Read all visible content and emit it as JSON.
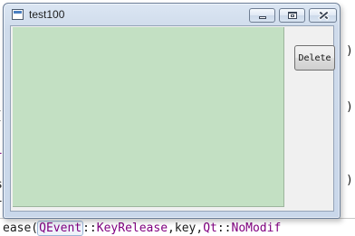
{
  "window": {
    "title": "test100",
    "delete_label": "Delete"
  },
  "editor": {
    "right_paren_1": ")",
    "right_paren_2": ")",
    "right_paren_3": ")",
    "left_fragments": [
      "(",
      "l",
      "s",
      "l"
    ],
    "code_line": {
      "prefix": "ease(",
      "class1": "QEvent",
      "sep1": "::",
      "enum1": "KeyRelease",
      "middle": ",key,",
      "class2": "Qt",
      "sep2": "::",
      "enum2": "NoModif"
    }
  }
}
